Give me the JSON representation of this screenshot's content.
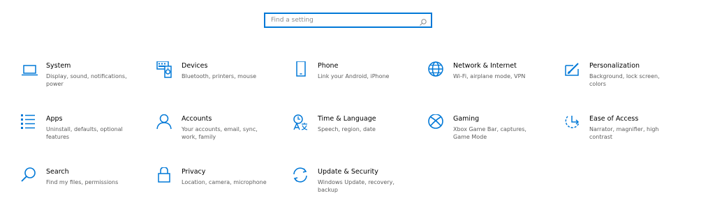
{
  "search": {
    "placeholder": "Find a setting"
  },
  "accent": "#0078d7",
  "tiles": [
    {
      "title": "System",
      "desc": "Display, sound, notifications, power",
      "icon": "laptop-icon"
    },
    {
      "title": "Devices",
      "desc": "Bluetooth, printers, mouse",
      "icon": "devices-icon"
    },
    {
      "title": "Phone",
      "desc": "Link your Android, iPhone",
      "icon": "phone-icon"
    },
    {
      "title": "Network & Internet",
      "desc": "Wi-Fi, airplane mode, VPN",
      "icon": "globe-icon"
    },
    {
      "title": "Personalization",
      "desc": "Background, lock screen, colors",
      "icon": "paint-icon"
    },
    {
      "title": "Apps",
      "desc": "Uninstall, defaults, optional features",
      "icon": "apps-list-icon"
    },
    {
      "title": "Accounts",
      "desc": "Your accounts, email, sync, work, family",
      "icon": "person-icon"
    },
    {
      "title": "Time & Language",
      "desc": "Speech, region, date",
      "icon": "time-language-icon"
    },
    {
      "title": "Gaming",
      "desc": "Xbox Game Bar, captures, Game Mode",
      "icon": "xbox-icon"
    },
    {
      "title": "Ease of Access",
      "desc": "Narrator, magnifier, high contrast",
      "icon": "ease-of-access-icon"
    },
    {
      "title": "Search",
      "desc": "Find my files, permissions",
      "icon": "magnifier-icon"
    },
    {
      "title": "Privacy",
      "desc": "Location, camera, microphone",
      "icon": "lock-icon"
    },
    {
      "title": "Update & Security",
      "desc": "Windows Update, recovery, backup",
      "icon": "sync-arrows-icon"
    }
  ]
}
